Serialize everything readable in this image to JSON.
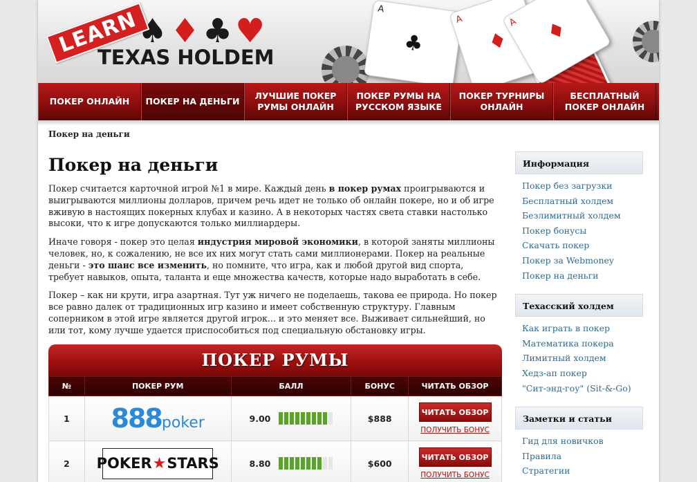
{
  "header": {
    "logo_learn": "LEARN",
    "logo_main": "TEXAS HOLDEM",
    "card_ace": "A",
    "card_clubs": "♣",
    "card_diamonds": "♦"
  },
  "nav": [
    {
      "label": "ПОКЕР ОНЛАЙН"
    },
    {
      "label": "ПОКЕР НА ДЕНЬГИ"
    },
    {
      "label": "ЛУЧШИЕ ПОКЕР РУМЫ ОНЛАЙН"
    },
    {
      "label": "ПОКЕР РУМЫ НА РУССКОМ ЯЗЫКЕ"
    },
    {
      "label": "ПОКЕР ТУРНИРЫ ОНЛАЙН"
    },
    {
      "label": "БЕСПЛАТНЫЙ ПОКЕР ОНЛАЙН"
    }
  ],
  "breadcrumb": "Покер на деньги",
  "main": {
    "title": "Покер на деньги",
    "p1": {
      "a": "Покер считается карточной игрой №1 в мире. Каждый день ",
      "b": "в покер румах",
      "c": " проигрываются и выигрываются миллионы долларов, причем речь идет не только об онлайн покере, но и об игре вживую в настоящих покерных клубах и казино. А в некоторых частях света ставки настолько высоки, что к игре допускаются только миллиардеры."
    },
    "p2": {
      "a": "Иначе говоря - покер это целая ",
      "b": "индустрия мировой экономики",
      "c": ", в которой заняты миллионы человек, но, к сожалению, не все их них могут стать сами миллионерами. Покер на реальные деньги - ",
      "d": "это шанс все изменить",
      "e": ", но помните, что игра, как и любой другой вид спорта, требует навыков, опыта, таланта и еще множества качеств, которые надо выработать в себе."
    },
    "p3": "Покер – как ни крути, игра азартная. Тут уж ничего не поделаешь, такова ее природа. Но покер все равно далек от традиционных игр казино и имеет собственную структуру. Главным соперником в этой игре является другой игрок... и это меняет все. Выживает сильнейший, но или тот, кому лучше удается приспособиться под специальную обстановку игры."
  },
  "rooms": {
    "heading": "ПОКЕР РУМЫ",
    "columns": [
      "№",
      "ПОКЕР РУМ",
      "БАЛЛ",
      "БОНУС",
      "ЧИТАТЬ ОБЗОР"
    ],
    "rows": [
      {
        "num": "1",
        "logo_a": "888",
        "logo_b": "poker",
        "score": "9.00",
        "score_fraction": 0.9,
        "bonus": "$888",
        "read": "ЧИТАТЬ ОБЗОР",
        "get_bonus": "ПОЛУЧИТЬ БОНУС"
      },
      {
        "num": "2",
        "logo_a": "POKER",
        "logo_star": "★",
        "logo_b": "STARS",
        "score": "8.80",
        "score_fraction": 0.8,
        "bonus": "$600",
        "read": "ЧИТАТЬ ОБЗОР",
        "get_bonus": "ПОЛУЧИТЬ БОНУС"
      }
    ]
  },
  "sidebar": [
    {
      "title": "Информация",
      "links": [
        "Покер без загрузки",
        "Бесплатный холдем",
        "Безлимитный холдем",
        "Покер бонусы",
        "Скачать покер",
        "Покер за Webmoney",
        "Покер на деньги"
      ]
    },
    {
      "title": "Техасский холдем",
      "links": [
        "Как играть в покер",
        "Математика покера",
        "Лимитный холдем",
        "Хедз-ап покер",
        "\"Сит-энд-гоу\" (Sit-&-Go)"
      ]
    },
    {
      "title": "Заметки и статьи",
      "links": [
        "Гид для новичков",
        "Правила",
        "Стратегии"
      ]
    }
  ]
}
